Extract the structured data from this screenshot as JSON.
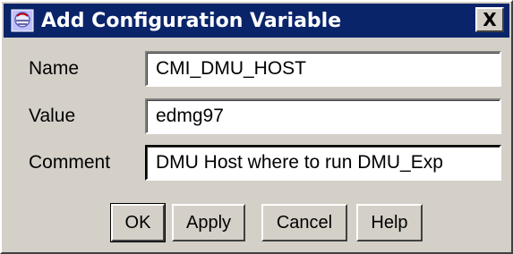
{
  "window": {
    "title": "Add Configuration Variable",
    "icon": "app-icon",
    "close_label": "X"
  },
  "form": {
    "name_label": "Name",
    "name_value": "CMI_DMU_HOST",
    "value_label": "Value",
    "value_value": "edmg97",
    "comment_label": "Comment",
    "comment_value": "DMU Host where to run DMU_Exp"
  },
  "buttons": {
    "ok": "OK",
    "apply": "Apply",
    "cancel": "Cancel",
    "help": "Help"
  },
  "colors": {
    "titlebar": "#0a246a",
    "face": "#d4d0c8"
  }
}
